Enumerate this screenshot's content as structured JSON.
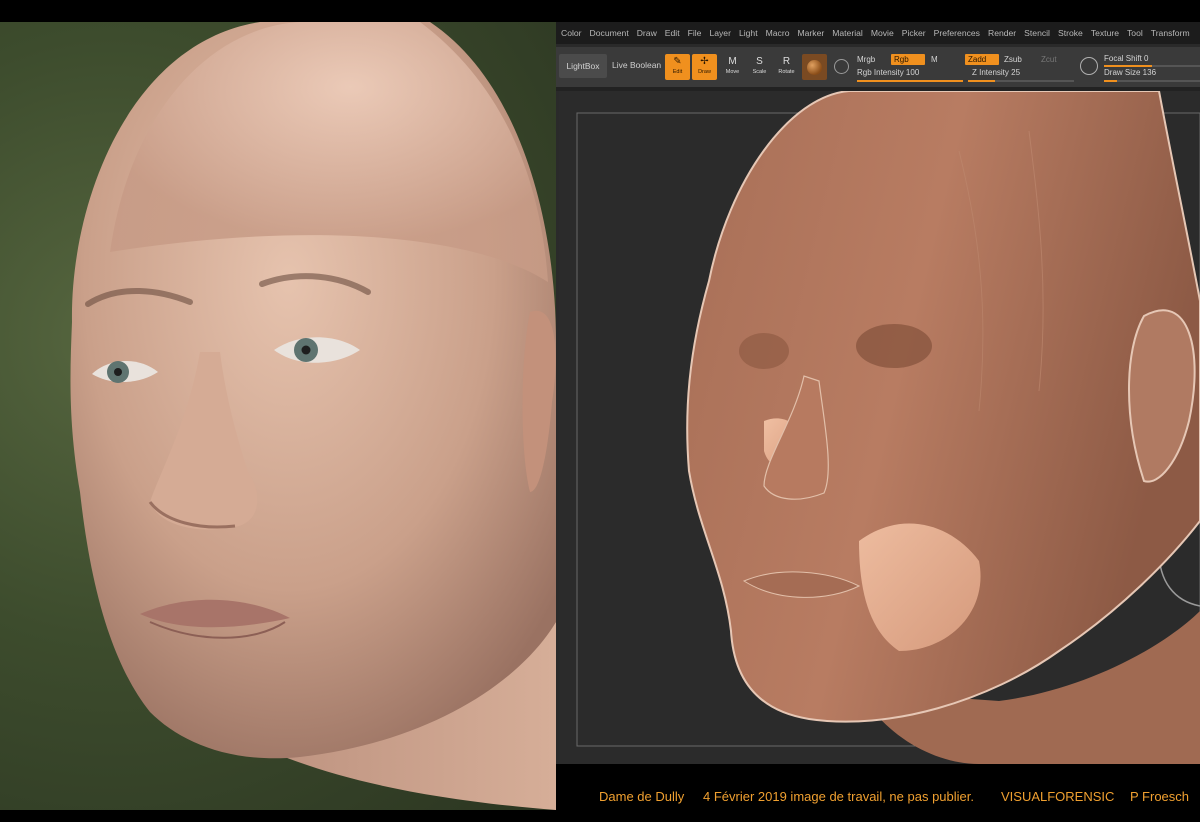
{
  "zbrush": {
    "menu_items": [
      "Color",
      "Document",
      "Draw",
      "Edit",
      "File",
      "Layer",
      "Light",
      "Macro",
      "Marker",
      "Material",
      "Movie",
      "Picker",
      "Preferences",
      "Render",
      "Stencil",
      "Stroke",
      "Texture",
      "Tool",
      "Transform"
    ],
    "toolbar": {
      "lightbox_label": "LightBox",
      "live_boolean_label": "Live Boolean",
      "edit_label": "Edit",
      "draw_label": "Draw",
      "move_label": "Move",
      "scale_label": "Scale",
      "rotate_label": "Rotate",
      "mrgb_label": "Mrgb",
      "rgb_label": "Rgb",
      "m_label": "M",
      "rgb_intensity_label": "Rgb Intensity 100",
      "rgb_intensity_value": 100,
      "zadd_label": "Zadd",
      "zsub_label": "Zsub",
      "zcut_label": "Zcut",
      "z_intensity_label": "Z Intensity 25",
      "z_intensity_value": 25,
      "focal_shift_label": "Focal Shift 0",
      "focal_shift_value": 0,
      "draw_size_label": "Draw Size 136",
      "draw_size_value": 136
    },
    "accent_color": "#f0901e"
  },
  "caption": {
    "subject": "Dame de Dully",
    "date_note": "4 Février 2019  image de travail, ne pas publier.",
    "studio": "VISUALFORENSIC",
    "author": "P Froesch"
  }
}
